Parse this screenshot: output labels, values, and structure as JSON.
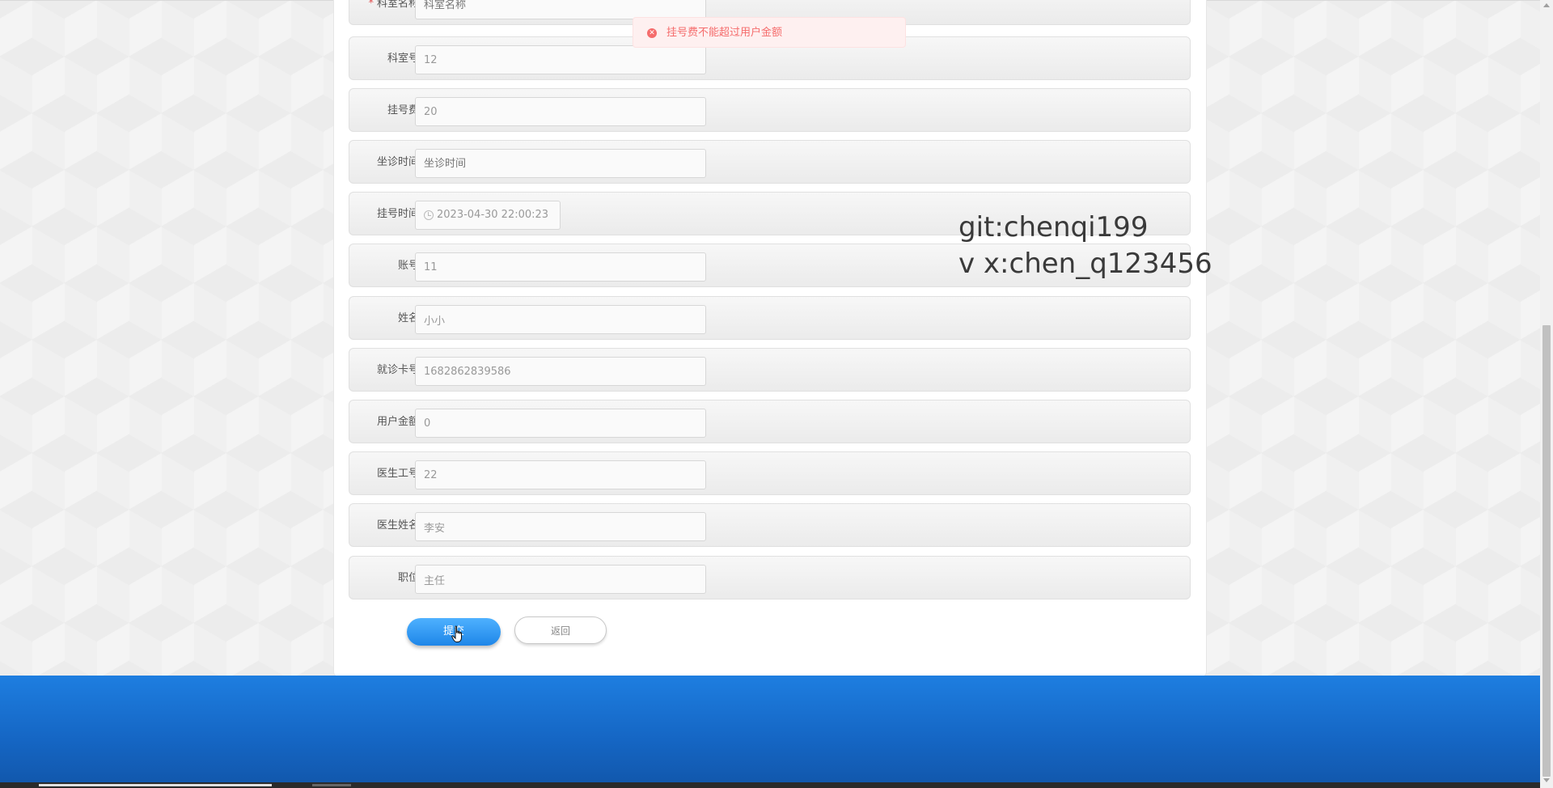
{
  "toast": {
    "icon": "error-circle-icon",
    "message": "挂号费不能超过用户金额"
  },
  "watermark": {
    "line1": "git:chenqi199",
    "line2": "v x:chen_q123456"
  },
  "form": {
    "fields": [
      {
        "label": "科室名称",
        "required": true,
        "value": "",
        "placeholder": "科室名称"
      },
      {
        "label": "科室号",
        "value": "12"
      },
      {
        "label": "挂号费",
        "value": "20"
      },
      {
        "label": "坐诊时间",
        "value": "",
        "placeholder": "坐诊时间"
      },
      {
        "label": "挂号时间",
        "value": "2023-04-30 22:00:23",
        "icon": "clock-icon"
      },
      {
        "label": "账号",
        "value": "11"
      },
      {
        "label": "姓名",
        "value": "小小"
      },
      {
        "label": "就诊卡号",
        "value": "1682862839586"
      },
      {
        "label": "用户金额",
        "value": "0"
      },
      {
        "label": "医生工号",
        "value": "22"
      },
      {
        "label": "医生姓名",
        "value": "李安"
      },
      {
        "label": "职位",
        "value": "主任"
      }
    ],
    "required_mark": "*",
    "submit_label": "提交",
    "back_label": "返回"
  },
  "colors": {
    "primary": "#1e86e8",
    "error": "#f56c6c",
    "footer": "#1566c4"
  }
}
